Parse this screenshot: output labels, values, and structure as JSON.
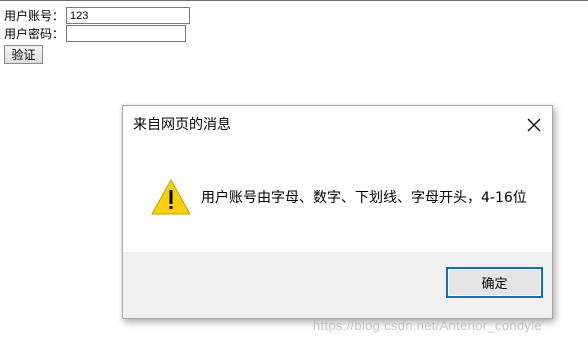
{
  "form": {
    "account_label": "用户账号：",
    "account_value": "123",
    "password_label": "用户密码：",
    "password_value": "",
    "verify_button": "验证"
  },
  "dialog": {
    "title": "来自网页的消息",
    "close_icon": "close-icon",
    "warning_icon": "warning-triangle-icon",
    "message": "用户账号由字母、数字、下划线、字母开头，4-16位",
    "ok_button": "确定",
    "accent_color": "#0b6fcf",
    "warning_color": "#f9d100"
  },
  "watermark": "https://blog.csdn.net/Anterior_condyle"
}
